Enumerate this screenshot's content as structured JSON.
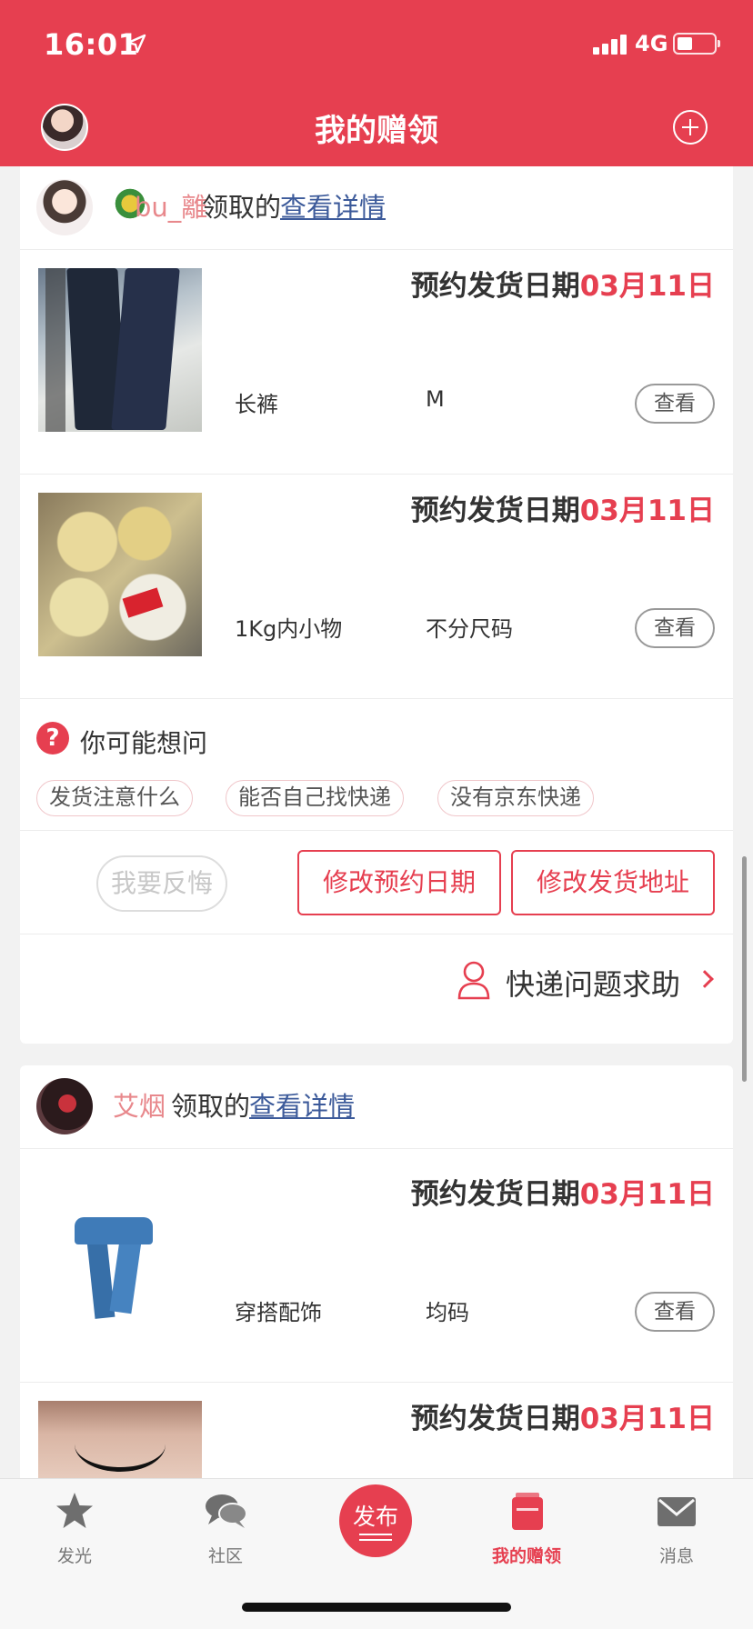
{
  "status": {
    "time": "16:01",
    "network": "4G"
  },
  "header": {
    "title": "我的赠领"
  },
  "claims": [
    {
      "user": "bu_離",
      "claimed_text": "领取的",
      "detail_link": "查看详情",
      "items": [
        {
          "date_label": "预约发货日期",
          "date": "03月11日",
          "category": "长裤",
          "size": "M",
          "view": "查看",
          "thumb": "dark-pants"
        },
        {
          "date_label": "预约发货日期",
          "date": "03月11日",
          "category": "1Kg内小物",
          "size": "不分尺码",
          "view": "查看",
          "thumb": "rice-crackers"
        }
      ],
      "faq": {
        "title": "你可能想问",
        "chips": [
          "发货注意什么",
          "能否自己找快递",
          "没有京东快递"
        ]
      },
      "actions": {
        "regret": "我要反悔",
        "change_date": "修改预约日期",
        "change_address": "修改发货地址"
      },
      "help": {
        "label": "快递问题求助"
      }
    },
    {
      "user": "艾烟",
      "claimed_text": "领取的",
      "detail_link": "查看详情",
      "items": [
        {
          "date_label": "预约发货日期",
          "date": "03月11日",
          "category": "穿搭配饰",
          "size": "均码",
          "view": "查看",
          "thumb": "blue-scarf"
        },
        {
          "date_label": "预约发货日期",
          "date": "03月11日",
          "thumb": "choker"
        }
      ]
    }
  ],
  "tabbar": {
    "tabs": [
      {
        "label": "发光",
        "icon": "star-icon",
        "active": false
      },
      {
        "label": "社区",
        "icon": "chat-icon",
        "active": false
      },
      {
        "label": "发布",
        "icon": "publish-icon",
        "active": false
      },
      {
        "label": "我的赠领",
        "icon": "gift-book-icon",
        "active": true
      },
      {
        "label": "消息",
        "icon": "mail-icon",
        "active": false
      }
    ]
  },
  "colors": {
    "brand": "#e63f50",
    "link": "#3c5a9a",
    "username": "#e8888c"
  }
}
